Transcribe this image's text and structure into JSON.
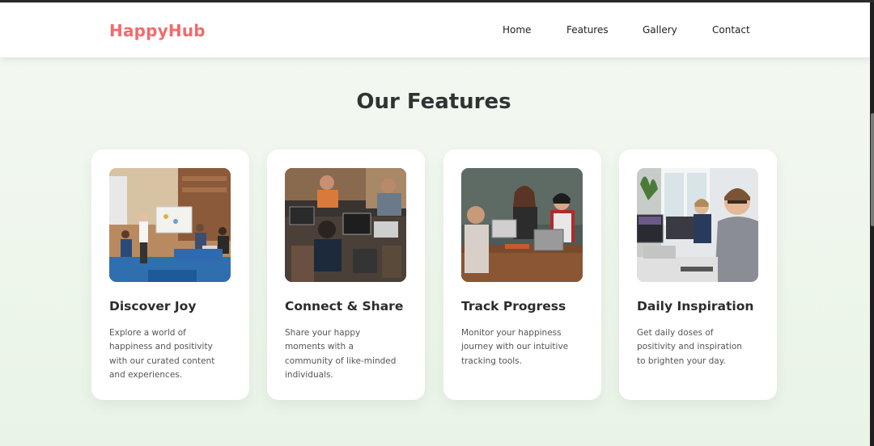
{
  "header": {
    "brand": "HappyHub",
    "nav": [
      "Home",
      "Features",
      "Gallery",
      "Contact"
    ]
  },
  "features_section": {
    "title": "Our Features",
    "cards": [
      {
        "title": "Discover Joy",
        "text": "Explore a world of happiness and positivity with our curated content and experiences.",
        "image_icon": "team-presentation-photo"
      },
      {
        "title": "Connect & Share",
        "text": "Share your happy moments with a community of like-minded individuals.",
        "image_icon": "coworking-laptops-photo"
      },
      {
        "title": "Track Progress",
        "text": "Monitor your happiness journey with our intuitive tracking tools.",
        "image_icon": "friends-laughing-photo"
      },
      {
        "title": "Daily Inspiration",
        "text": "Get daily doses of positivity and inspiration to brighten your day.",
        "image_icon": "office-desk-photo"
      }
    ]
  },
  "colors": {
    "brand": "#f26b6b",
    "background": "#f0f6ee",
    "card": "#ffffff",
    "heading": "#2f3433"
  }
}
